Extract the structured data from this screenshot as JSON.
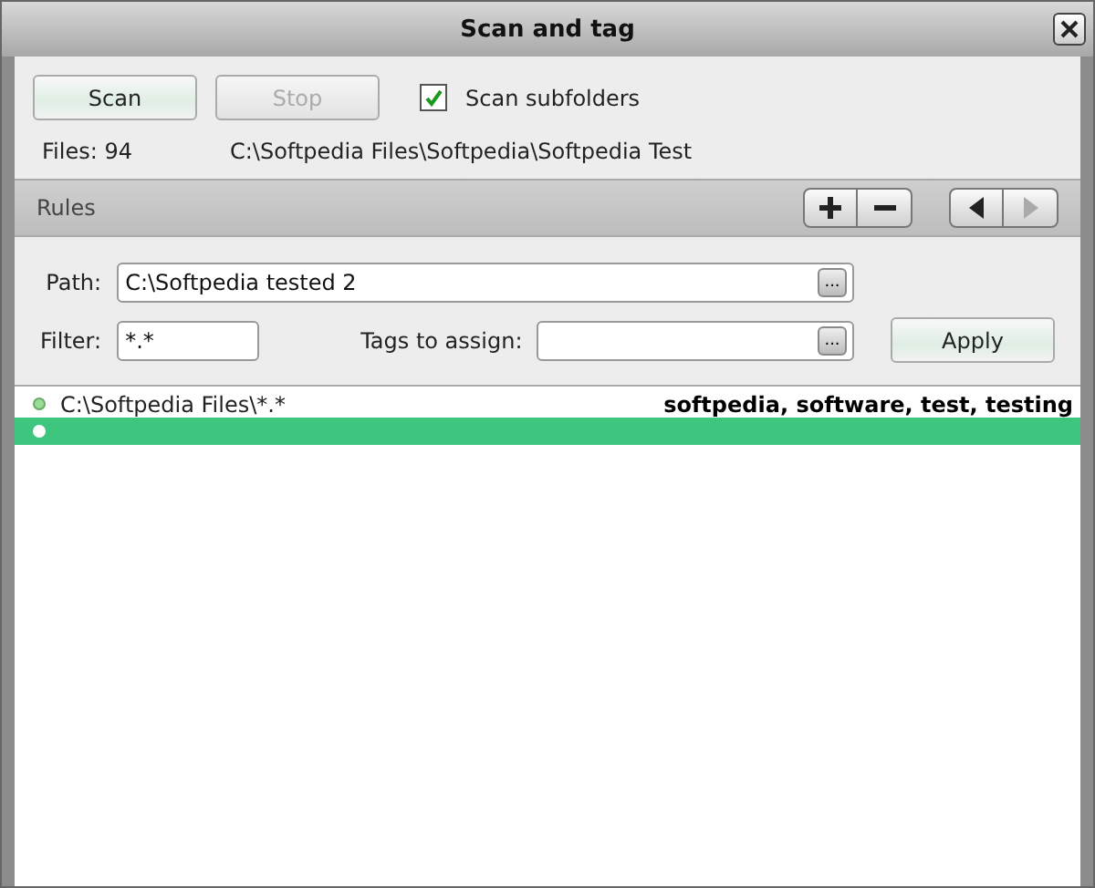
{
  "window": {
    "title": "Scan and tag"
  },
  "scan": {
    "buttons": [
      {
        "label": "Scan",
        "disabled": false
      },
      {
        "label": "Stop",
        "disabled": true
      }
    ],
    "subfolders": {
      "label": "Scan subfolders",
      "checked": true
    },
    "files_label": "Files: 94",
    "current_path": "C:\\Softpedia Files\\Softpedia\\Softpedia Test"
  },
  "rules": {
    "title": "Rules",
    "tools": [
      {
        "kind": "add",
        "disabled": false
      },
      {
        "kind": "remove",
        "disabled": false
      },
      {
        "kind": "prev",
        "disabled": false
      },
      {
        "kind": "next",
        "disabled": true
      }
    ],
    "path_label": "Path:",
    "path_value": "C:\\Softpedia tested 2",
    "browse": "...",
    "filter_label": "Filter:",
    "filter_value": "*.*",
    "tags_label": "Tags to assign:",
    "tags_browse": "...",
    "apply": "Apply",
    "items": [
      {
        "path": "C:\\Softpedia Files\\*.*",
        "tags": "softpedia, software, test, testing",
        "selected": false
      },
      {
        "selected": true
      }
    ]
  }
}
